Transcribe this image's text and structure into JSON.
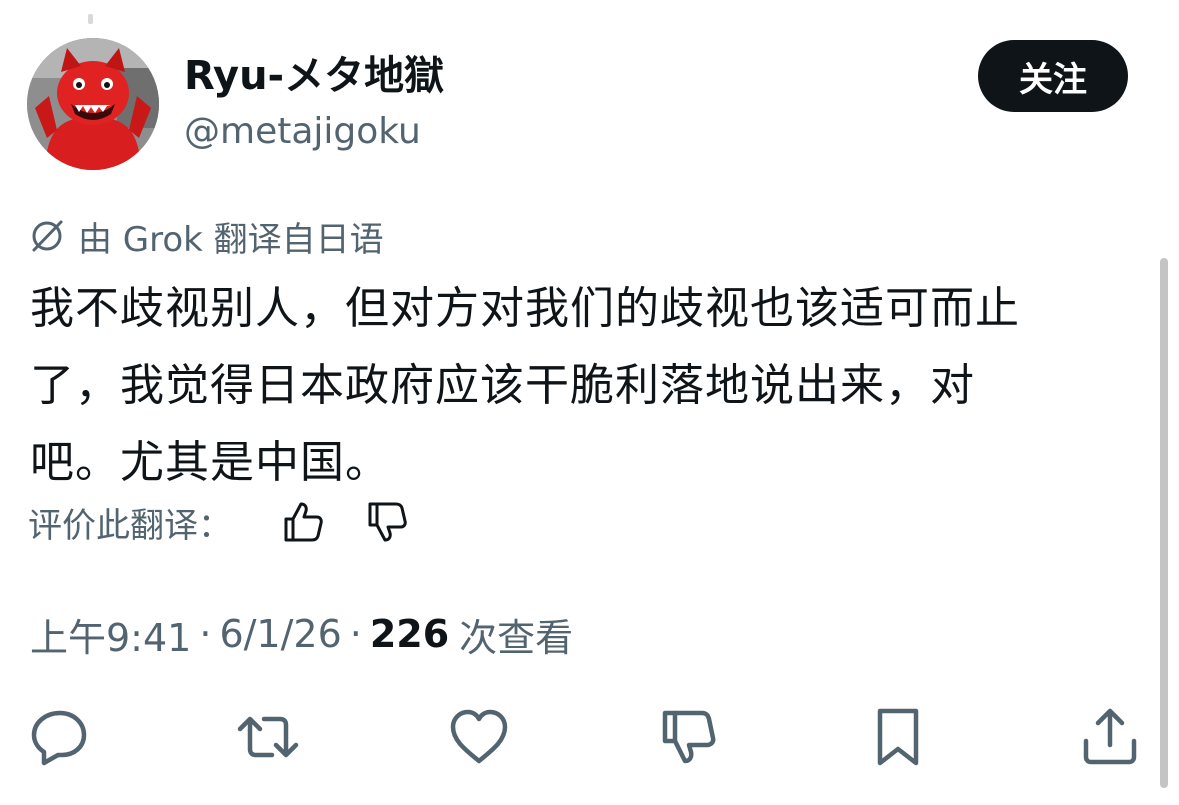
{
  "author": {
    "display_name": "Ryu-メタ地獄",
    "handle": "@metajigoku",
    "avatar_icon": "red-mascot-avatar"
  },
  "follow_button": {
    "label": "关注"
  },
  "translation": {
    "notice": "由 Grok 翻译自日语",
    "icon": "grok-icon"
  },
  "tweet": {
    "lines": [
      "我不歧视别人，但对方对我们的歧视也该适可而止",
      "了，我觉得日本政府应该干脆利落地说出来，对",
      "吧。尤其是中国。"
    ]
  },
  "rate_translation": {
    "label": "评价此翻译：",
    "icons": [
      "thumbs-up-icon",
      "thumbs-down-icon"
    ]
  },
  "meta": {
    "time": "上午9:41",
    "separator": "·",
    "date": "6/1/26",
    "views_count": "226",
    "views_label": "次查看"
  },
  "actions": [
    "reply-icon",
    "retweet-icon",
    "like-icon",
    "dislike-icon",
    "bookmark-icon",
    "share-icon"
  ],
  "colors": {
    "text_primary": "#0f1419",
    "text_secondary": "#536471",
    "button_bg": "#0f1419",
    "mascot_red": "#d81e1e"
  }
}
